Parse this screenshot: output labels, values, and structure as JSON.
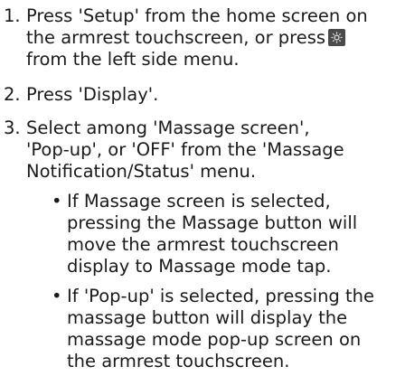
{
  "steps": [
    {
      "number": "1.",
      "line1_a": "Press 'Setup' from the home screen on",
      "line2": "the armrest touchscreen, or press",
      "line3": "from the left side menu.",
      "icon": "gear-icon"
    },
    {
      "number": "2.",
      "line1": "Press 'Display'."
    },
    {
      "number": "3.",
      "line1": "Select among 'Massage screen',",
      "line2": "'Pop-up', or 'OFF' from the 'Massage",
      "line3": "Notification/Status' menu."
    }
  ],
  "bullets": [
    {
      "symbol": "•",
      "lines": [
        "If Massage screen is selected,",
        "pressing the Massage button will",
        "move the armrest touchscreen",
        "display to Massage mode tap."
      ]
    },
    {
      "symbol": "•",
      "lines": [
        "If 'Pop-up' is selected, pressing the",
        "massage button will display the",
        "massage mode pop-up screen on",
        "the armrest touchscreen."
      ]
    }
  ],
  "colors": {
    "text": "#1a1a1a",
    "icon_bg": "#4a4a4a"
  }
}
